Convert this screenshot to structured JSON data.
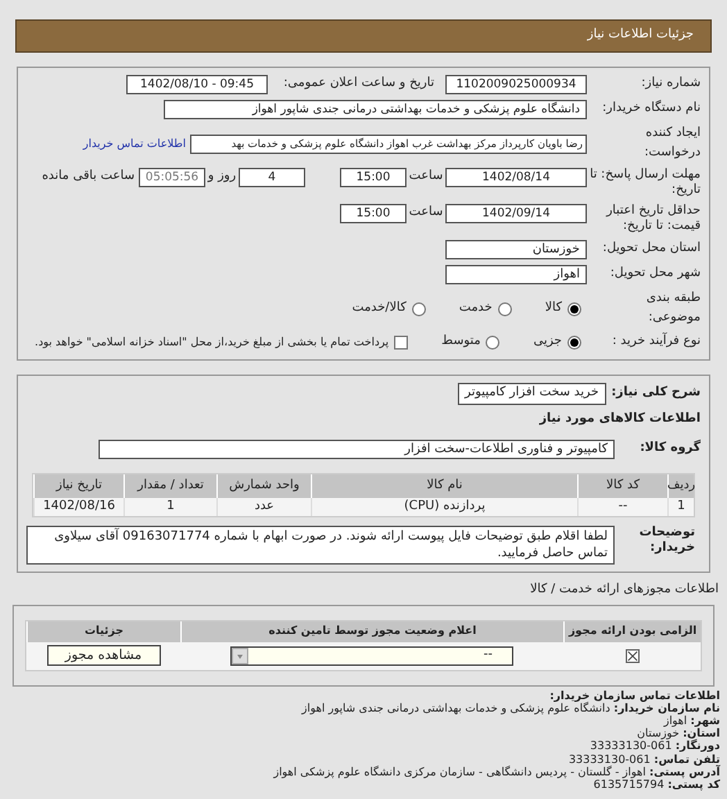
{
  "header": {
    "title": "جزئیات اطلاعات نیاز"
  },
  "need_info": {
    "need_number": {
      "label": "شماره نیاز:",
      "value": "1102009025000934"
    },
    "announce_datetime": {
      "label": "تاریخ و ساعت اعلان عمومی:",
      "value": "1402/08/10 - 09:45"
    },
    "buyer_org": {
      "label": "نام دستگاه خریدار:",
      "value": "دانشگاه علوم پزشکی و خدمات بهداشتی درمانی جندی شاپور اهواز"
    },
    "requester": {
      "label": "ایجاد کننده درخواست:",
      "value": "رضا باویان کارپرداز مرکز بهداشت غرب اهواز دانشگاه علوم پزشکی و خدمات بهد",
      "link": "اطلاعات تماس خریدار"
    },
    "reply_deadline": {
      "label": "مهلت ارسال پاسخ: تا تاریخ:",
      "date": "1402/08/14",
      "time_label": "ساعت",
      "time": "15:00",
      "days": "4",
      "days_label": "روز و",
      "remaining": "05:05:56",
      "remaining_label": "ساعت باقی مانده"
    },
    "price_validity": {
      "label": "حداقل تاریخ اعتبار قیمت: تا تاریخ:",
      "date": "1402/09/14",
      "time_label": "ساعت",
      "time": "15:00"
    },
    "province": {
      "label": "استان محل تحویل:",
      "value": "خوزستان"
    },
    "city": {
      "label": "شهر محل تحویل:",
      "value": "اهواز"
    },
    "category": {
      "label": "طبقه بندی موضوعی:",
      "options": [
        {
          "label": "کالا",
          "selected": true
        },
        {
          "label": "خدمت",
          "selected": false
        },
        {
          "label": "کالا/خدمت",
          "selected": false
        }
      ]
    },
    "purchase_process": {
      "label": "نوع فرآیند خرید :",
      "options": [
        {
          "label": "جزیی",
          "selected": true
        },
        {
          "label": "متوسط",
          "selected": false
        }
      ],
      "treasury": {
        "label": "پرداخت تمام یا بخشی از مبلغ خرید،از محل \"اسناد خزانه اسلامی\" خواهد بود.",
        "checked": false
      }
    }
  },
  "goods": {
    "summary_label": "شرح کلی نیاز:",
    "summary": "خرید سخت افزار کامپیوتر",
    "section_title": "اطلاعات کالاهای مورد نیاز",
    "group_label": "گروه کالا:",
    "group": "کامپیوتر و فناوری اطلاعات-سخت افزار",
    "columns": [
      "ردیف",
      "کد کالا",
      "نام کالا",
      "واحد شمارش",
      "تعداد / مقدار",
      "تاریخ نیاز"
    ],
    "rows": [
      [
        "1",
        "--",
        "پردازنده (CPU)",
        "عدد",
        "1",
        "1402/08/16"
      ]
    ],
    "notes_label": "توضیحات خریدار:",
    "notes": "لطفا اقلام طبق توضیحات فایل پیوست ارائه شوند. در صورت ابهام با شماره 09163071774 آقای سیلاوی تماس حاصل فرمایید."
  },
  "licenses": {
    "title": "اطلاعات مجوزهای ارائه خدمت / کالا",
    "columns": [
      "الزامی بودن ارائه مجوز",
      "اعلام وضعیت مجوز توسط تامین کننده",
      "جزئیات"
    ],
    "rows": [
      {
        "required": true,
        "status": "--",
        "button": "مشاهده مجوز"
      }
    ]
  },
  "contact": {
    "title": "اطلاعات تماس سازمان خریدار:",
    "fields": [
      {
        "label": "نام سازمان خریدار:",
        "value": "دانشگاه علوم پزشکی و خدمات بهداشتی درمانی جندی شاپور اهواز"
      },
      {
        "label": "شهر:",
        "value": "اهواز"
      },
      {
        "label": "استان:",
        "value": "خوزستان"
      },
      {
        "label": "دورنگار:",
        "value": "061-33333130"
      },
      {
        "label": "تلفن تماس:",
        "value": "061-33333130"
      },
      {
        "label": "آدرس پستی:",
        "value": "اهواز - گلستان - پردیس دانشگاهی - سازمان مرکزی دانشگاه علوم پزشکی اهواز"
      },
      {
        "label": "کد پستی:",
        "value": "6135715794"
      }
    ]
  }
}
